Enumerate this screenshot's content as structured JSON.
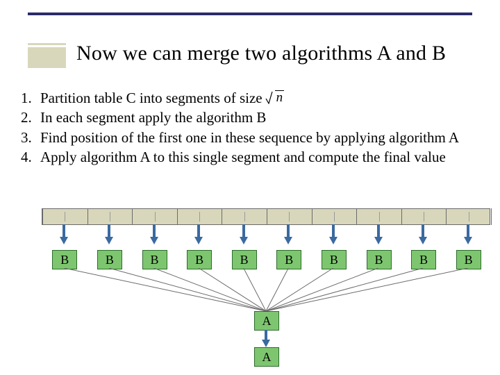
{
  "title": "Now we can merge two algorithms A and B",
  "list": [
    {
      "n": "1.",
      "t": "Partition table C into segments of size",
      "sqrt": "n"
    },
    {
      "n": "2.",
      "t": "In each segment apply the algorithm B"
    },
    {
      "n": "3.",
      "t": "Find position of the first one in these sequence by applying algorithm A"
    },
    {
      "n": "4.",
      "t": "Apply algorithm A to this single segment and compute the final value"
    }
  ],
  "diagram": {
    "segments": 10,
    "ticks_per_segment": 2,
    "b_label": "B",
    "a_label": "A"
  }
}
